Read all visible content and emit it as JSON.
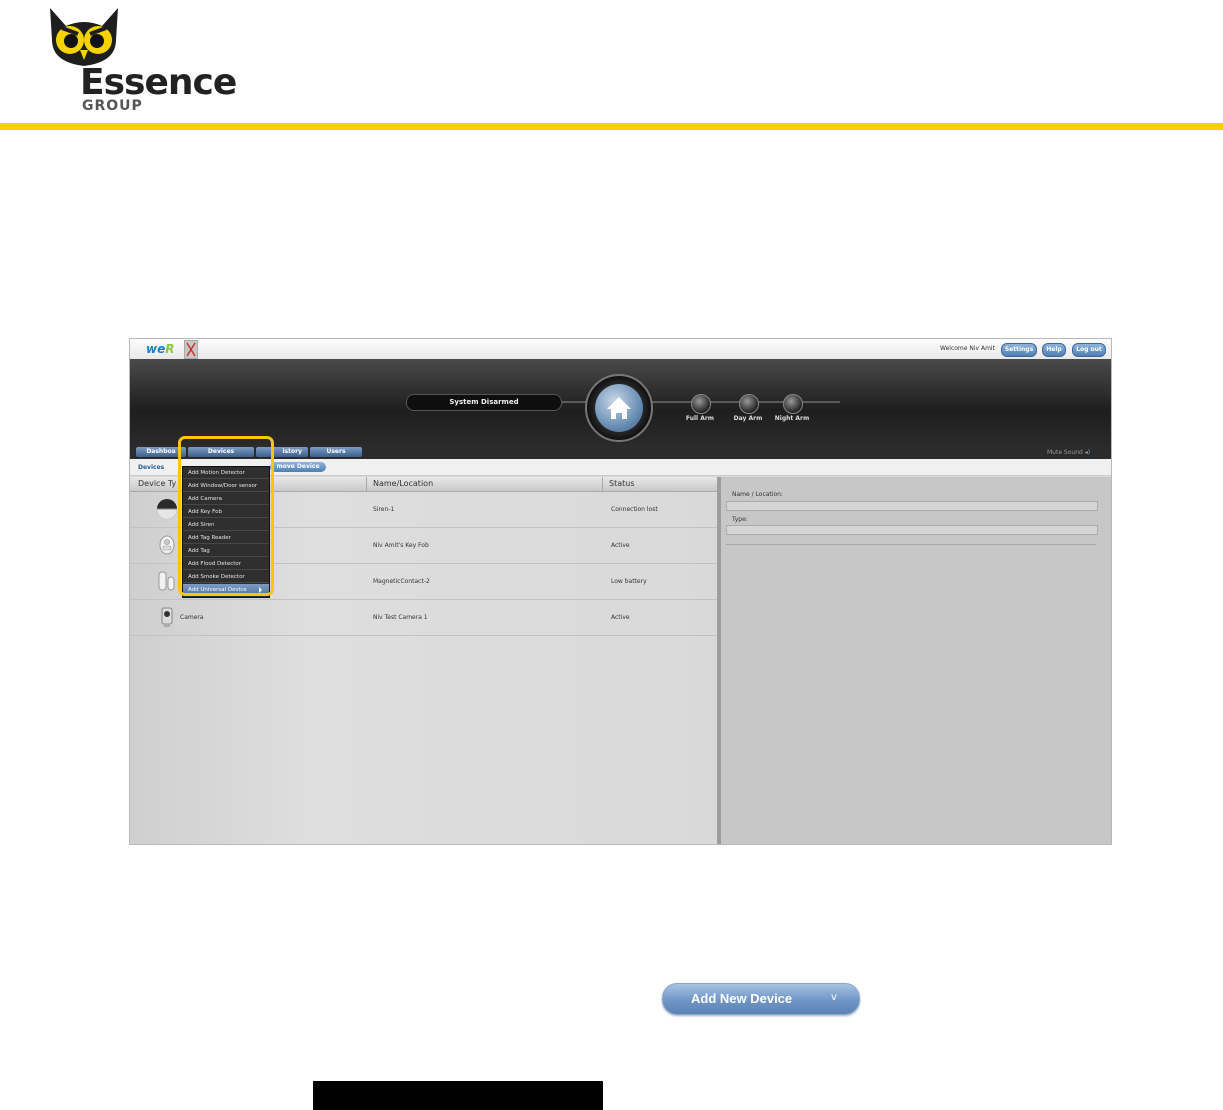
{
  "logo": {
    "word": "Essence",
    "group": "GROUP"
  },
  "topbar": {
    "brand_main": "we",
    "brand_accent": "R",
    "welcome": "Welcome  Niv Amit",
    "settings": "Settings",
    "help": "Help",
    "logout": "Log out"
  },
  "header": {
    "status": "System Disarmed",
    "arm_buttons": [
      "Full Arm",
      "Day Arm",
      "Night Arm"
    ]
  },
  "nav": {
    "tabs": [
      "Dashboa",
      "Devices",
      "istory",
      "Users"
    ],
    "mute": "Mute Sound"
  },
  "subnav": {
    "crumb": "Devices",
    "remove": "move Device"
  },
  "table": {
    "columns": [
      "Device Ty",
      "Name/Location",
      "Status"
    ],
    "rows": [
      {
        "type": "",
        "name": "Siren-1",
        "status": "Connection lost",
        "icon": "siren-icon"
      },
      {
        "type": "",
        "name": "Niv Amit's Key Fob",
        "status": "Active",
        "icon": "key-fob-icon"
      },
      {
        "type": "",
        "name": "MagneticContact-2",
        "status": "Low battery",
        "icon": "magnetic-contact-icon"
      },
      {
        "type": "Camera",
        "name": "Niv Test Camera 1",
        "status": "Active",
        "icon": "camera-icon"
      }
    ]
  },
  "details": {
    "name_label": "Name / Location:",
    "type_label": "Type:"
  },
  "dropdown": {
    "items": [
      "Add Motion Detector",
      "Add Window/Door sensor",
      "Add Camera",
      "Add Key Fob",
      "Add Siren",
      "Add Tag Reader",
      "Add Tag",
      "Add Flood Detector",
      "Add Smoke Detector",
      "Add Universal Device"
    ],
    "selected_index": 9
  },
  "add_new": {
    "label": "Add New Device",
    "chevron": "v"
  },
  "colors": {
    "accent_yellow": "#f5d300",
    "button_blue": "#6f95c4"
  }
}
